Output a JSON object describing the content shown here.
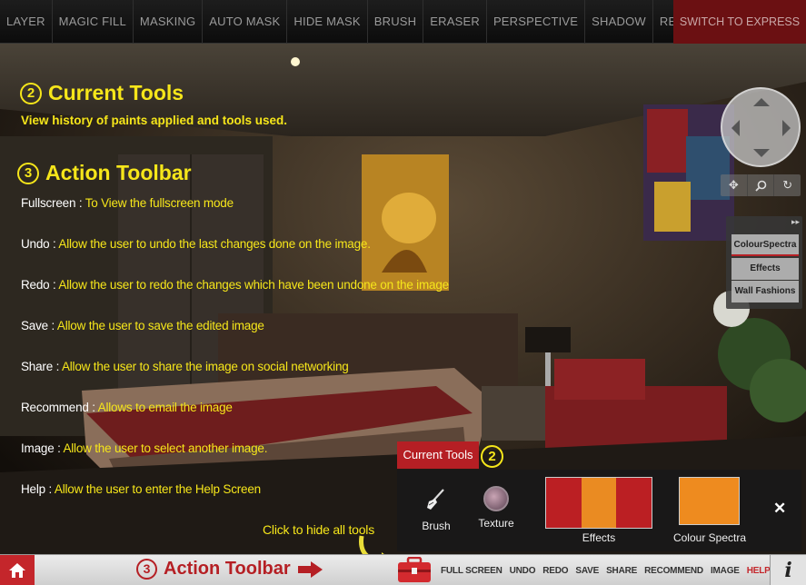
{
  "top_bar": {
    "tools": [
      "LAYER",
      "MAGIC FILL",
      "MASKING",
      "AUTO MASK",
      "HIDE MASK",
      "BRUSH",
      "ERASER",
      "PERSPECTIVE",
      "SHADOW",
      "RESET"
    ],
    "switch_label": "SWITCH TO EXPRESS"
  },
  "help": {
    "current_tools": {
      "number": "2",
      "title": "Current Tools",
      "desc": "View history of paints applied and tools used."
    },
    "action_toolbar": {
      "number": "3",
      "title": "Action Toolbar",
      "items": [
        {
          "term": "Fullscreen :",
          "desc": "To View the fullscreen mode"
        },
        {
          "term": "Undo :",
          "desc": "Allow the user to undo the last changes done on the image."
        },
        {
          "term": "Redo :",
          "desc": "Allow the user to redo the changes which have been undone on the image"
        },
        {
          "term": "Save :",
          "desc": "Allow the user to save the edited image"
        },
        {
          "term": "Share :",
          "desc": "Allow the user to share the image on social networking"
        },
        {
          "term": "Recommend :",
          "desc": "Allows to email the image"
        },
        {
          "term": "Image :",
          "desc": "Allow the user to select another image."
        },
        {
          "term": "Help :",
          "desc": "Allow the user to enter the Help Screen"
        }
      ]
    },
    "hide_hint": "Click to hide all tools"
  },
  "side_panel": {
    "collapse": "▸▸",
    "buttons": [
      "ColourSpectra",
      "Effects",
      "Wall Fashions"
    ]
  },
  "current_tools_panel": {
    "tab_label": "Current Tools",
    "number": "2",
    "brush_label": "Brush",
    "texture_label": "Texture",
    "effects_label": "Effects",
    "effects_colors": [
      "#bb1f23",
      "#ea8b22",
      "#bb1f23"
    ],
    "spectra_label": "Colour Spectra",
    "spectra_color": "#ee8b1f",
    "close": "✕"
  },
  "bottom_bar": {
    "label_number": "3",
    "label": "Action Toolbar",
    "actions": [
      "FULL SCREEN",
      "UNDO",
      "REDO",
      "SAVE",
      "SHARE",
      "RECOMMEND",
      "IMAGE",
      "HELP"
    ],
    "info": "i"
  },
  "colors": {
    "accent_yellow": "#f6e61a",
    "brand_red": "#b51f24"
  }
}
